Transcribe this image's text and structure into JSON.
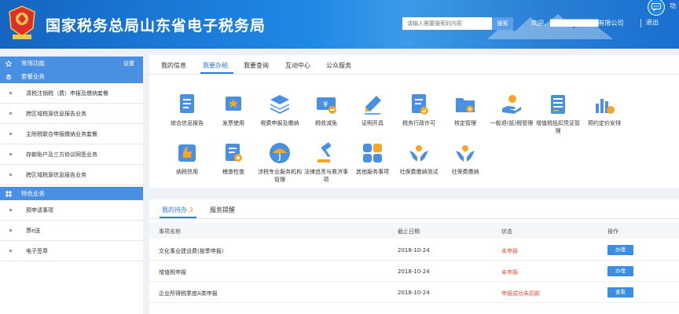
{
  "header": {
    "site_title": "国家税务总局山东省电子税务局",
    "search_placeholder": "请输入需要搜索的内容",
    "search_button": "搜索",
    "welcome": "欢迎，██████████有限公司",
    "logout": "退出",
    "chat_label": "功"
  },
  "sidebar": {
    "groups": [
      {
        "label": "常用功能",
        "extra": "设置"
      },
      {
        "label": "套餐业务"
      },
      {
        "label": "特色业务"
      }
    ],
    "package_items": [
      "清税注销税（费）申报及缴纳套餐",
      "跨区域税源信息报告业务",
      "主附税联合申报缴纳业务套餐",
      "存款账户及三方协议网签业务",
      "跨区域税源信息报告业务"
    ],
    "feature_items": [
      "预申请事项",
      "票e送",
      "电子签章"
    ]
  },
  "main": {
    "tabs": [
      "我的信息",
      "我要办税",
      "我要查询",
      "互动中心",
      "公众服务"
    ],
    "active_tab": "我要办税",
    "services": [
      {
        "label": "综合信息报告",
        "icon": "document-report-icon"
      },
      {
        "label": "发票使用",
        "icon": "invoice-star-icon"
      },
      {
        "label": "税费申报及缴纳",
        "icon": "layers-icon"
      },
      {
        "label": "税收减免",
        "icon": "yuan-ticket-icon"
      },
      {
        "label": "证明开具",
        "icon": "pen-icon"
      },
      {
        "label": "税务行政许可",
        "icon": "document-check-icon"
      },
      {
        "label": "核定管理",
        "icon": "folder-gear-icon"
      },
      {
        "label": "一般退(抵)税管理",
        "icon": "hand-coin-icon"
      },
      {
        "label": "增值税抵扣凭证管理",
        "icon": "ledger-icon"
      },
      {
        "label": "预约定价安排",
        "icon": "chart-coin-icon"
      },
      {
        "label": "纳税信用",
        "icon": "thumbs-up-icon"
      },
      {
        "label": "稽查检查",
        "icon": "inspect-icon"
      },
      {
        "label": "涉税专业服务机构管理",
        "icon": "umbrella-icon"
      },
      {
        "label": "法律追责与救济事项",
        "icon": "gavel-icon"
      },
      {
        "label": "其他服务事项",
        "icon": "grid-icon"
      },
      {
        "label": "社保费缴纳测试",
        "icon": "hands-people-icon"
      },
      {
        "label": "社保费缴纳",
        "icon": "hands-people-icon"
      }
    ]
  },
  "tasks": {
    "tab_todo": "我的待办",
    "todo_count": "3",
    "tab_reminder": "服务提醒",
    "columns": [
      "事项名称",
      "截止日期",
      "状态",
      "操作"
    ],
    "rows": [
      {
        "name": "文化事业建设费(按季申报）",
        "deadline": "2018-10-24",
        "status": "未申报",
        "action": "办理"
      },
      {
        "name": "增值税申报",
        "deadline": "2018-10-24",
        "status": "未申报",
        "action": "办理"
      },
      {
        "name": "企业所得税季度A类申报",
        "deadline": "2018-10-24",
        "status": "申报成功未扣款",
        "action": "查看"
      }
    ]
  },
  "colors": {
    "header_blue": "#1e88e5",
    "accent_blue": "#2d7be0",
    "sidebar_group": "#4a90e2",
    "status_red": "#e84a3c",
    "count_orange": "#f39800"
  }
}
